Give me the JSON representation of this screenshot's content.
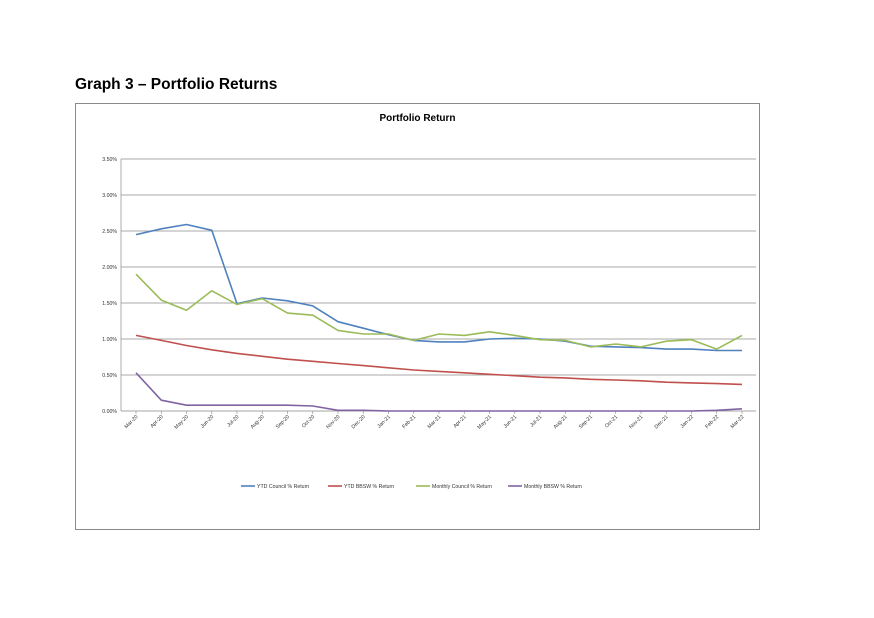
{
  "page": {
    "heading": "Graph 3 – Portfolio Returns"
  },
  "chart_data": {
    "type": "line",
    "title": "Portfolio Return",
    "xlabel": "",
    "ylabel": "",
    "ylim": [
      0,
      3.5
    ],
    "yticks": [
      "0.00%",
      "0.50%",
      "1.00%",
      "1.50%",
      "2.00%",
      "2.50%",
      "3.00%",
      "3.50%"
    ],
    "grid": true,
    "legend": "bottom",
    "categories": [
      "Mar-20",
      "Apr-20",
      "May-20",
      "Jun-20",
      "Jul-20",
      "Aug-20",
      "Sep-20",
      "Oct-20",
      "Nov-20",
      "Dec-20",
      "Jan-21",
      "Feb-21",
      "Mar-21",
      "Apr-21",
      "May-21",
      "Jun-21",
      "Jul-21",
      "Aug-21",
      "Sep-21",
      "Oct-21",
      "Nov-21",
      "Dec-21",
      "Jan-22",
      "Feb-22",
      "Mar-22"
    ],
    "series": [
      {
        "name": "YTD Council % Return",
        "color": "#4f81bd",
        "values": [
          2.45,
          2.53,
          2.59,
          2.51,
          1.49,
          1.57,
          1.53,
          1.46,
          1.24,
          1.15,
          1.06,
          0.98,
          0.96,
          0.96,
          1.0,
          1.01,
          1.0,
          0.97,
          0.9,
          0.89,
          0.88,
          0.86,
          0.86,
          0.84,
          0.84
        ]
      },
      {
        "name": "YTD BBSW % Return",
        "color": "#c0504d",
        "values": [
          1.05,
          0.98,
          0.91,
          0.85,
          0.8,
          0.76,
          0.72,
          0.69,
          0.66,
          0.63,
          0.6,
          0.57,
          0.55,
          0.53,
          0.51,
          0.49,
          0.47,
          0.46,
          0.44,
          0.43,
          0.42,
          0.4,
          0.39,
          0.38,
          0.37
        ]
      },
      {
        "name": "Monthly Council % Return",
        "color": "#9bbb59",
        "values": [
          1.9,
          1.54,
          1.4,
          1.67,
          1.48,
          1.56,
          1.36,
          1.33,
          1.12,
          1.07,
          1.07,
          0.98,
          1.07,
          1.05,
          1.1,
          1.05,
          0.99,
          0.98,
          0.89,
          0.93,
          0.89,
          0.97,
          0.99,
          0.86,
          1.05
        ]
      },
      {
        "name": "Monthly BBSW % Return",
        "color": "#8064a2",
        "values": [
          0.53,
          0.15,
          0.08,
          0.08,
          0.08,
          0.08,
          0.08,
          0.07,
          0.01,
          0.01,
          0.0,
          0.0,
          0.0,
          0.0,
          0.0,
          0.0,
          0.0,
          0.0,
          0.0,
          0.0,
          0.0,
          0.0,
          0.0,
          0.01,
          0.03
        ]
      }
    ]
  }
}
